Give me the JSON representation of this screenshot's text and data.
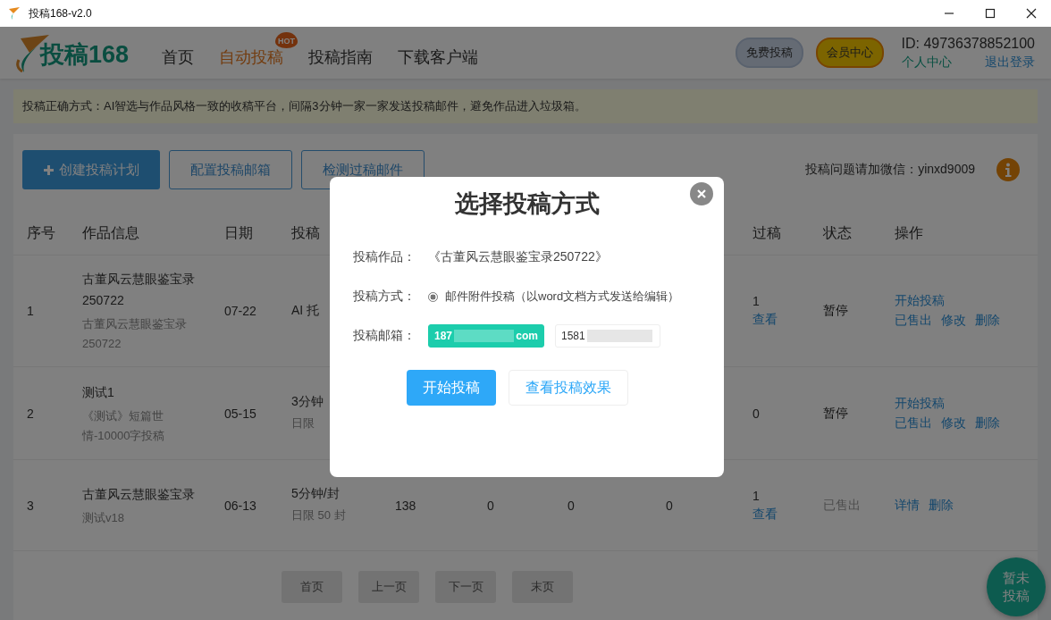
{
  "window": {
    "title": "投稿168-v2.0"
  },
  "header": {
    "logo_text": "投稿168",
    "nav": [
      {
        "label": "首页",
        "selected": false
      },
      {
        "label": "自动投稿",
        "selected": true,
        "badge": "HOT"
      },
      {
        "label": "投稿指南",
        "selected": false
      },
      {
        "label": "下载客户端",
        "selected": false
      }
    ],
    "pills": [
      {
        "label": "免费投稿",
        "kind": "free"
      },
      {
        "label": "会员中心",
        "kind": "vip"
      }
    ],
    "user_id": "ID: 49736378852100",
    "profile_link": "个人中心",
    "logout_link": "退出登录"
  },
  "notice": "投稿正确方式：AI智选与作品风格一致的收稿平台，间隔3分钟一家一家发送投稿邮件，避免作品进入垃圾箱。",
  "toolbar": {
    "buttons": [
      {
        "label": "创建投稿计划",
        "kind": "primary"
      },
      {
        "label": "配置投稿邮箱",
        "kind": "outline"
      },
      {
        "label": "检测过稿邮件",
        "kind": "outline"
      }
    ],
    "contact": "投稿问题请加微信：yinxd9009"
  },
  "table": {
    "columns": [
      "序号",
      "作品信息",
      "日期",
      "投稿",
      null,
      null,
      null,
      null,
      "过稿",
      "状态",
      "操作"
    ],
    "rows": [
      {
        "index": "1",
        "title": "古董风云慧眼鉴宝录250722",
        "subtitle": "古董风云慧眼鉴宝录250722",
        "date": "07-22",
        "rate": "AI 托",
        "cells": [],
        "passed": "1",
        "view": "查看",
        "status": "暂停",
        "greyed": false,
        "actions": [
          [
            "开始投稿"
          ],
          [
            "已售出",
            "修改",
            "删除"
          ]
        ]
      },
      {
        "index": "2",
        "title": "测试1",
        "subtitle": "《测试》短篇世情-10000字投稿",
        "date": "05-15",
        "rate": "3分钟",
        "limit": "日限",
        "cells": [],
        "passed": "0",
        "status": "暂停",
        "greyed": false,
        "actions": [
          [
            "开始投稿"
          ],
          [
            "已售出",
            "修改",
            "删除"
          ]
        ]
      },
      {
        "index": "3",
        "title": "古董风云慧眼鉴宝录",
        "subtitle": "测试v18",
        "date": "06-13",
        "rate": "5分钟/封",
        "limit": "日限 50 封",
        "cells": [
          "138",
          "0",
          "0",
          "0"
        ],
        "passed": "1",
        "view": "查看",
        "status": "已售出",
        "greyed": true,
        "actions": [
          [
            "详情",
            "删除"
          ]
        ]
      }
    ]
  },
  "pagination": [
    {
      "label": "首页",
      "disabled": true
    },
    {
      "label": "上一页",
      "disabled": true
    },
    {
      "label": "下一页",
      "disabled": true
    },
    {
      "label": "末页",
      "disabled": true
    }
  ],
  "float_button": "暂未投稿",
  "dialog": {
    "title": "选择投稿方式",
    "work_label": "投稿作品：",
    "work": "《古董风云慧眼鉴宝录250722》",
    "method_label": "投稿方式：",
    "methods": [
      {
        "label": "邮件附件投稿（以word文档方式发送给编辑）",
        "selected": true
      }
    ],
    "email_label": "投稿邮箱：",
    "emails": [
      {
        "prefix": "187",
        "suffix": "com",
        "selected": true
      },
      {
        "prefix": "1581",
        "selected": false
      }
    ],
    "buttons": [
      {
        "label": "开始投稿",
        "kind": "primary"
      },
      {
        "label": "查看投稿效果",
        "kind": "outline"
      }
    ]
  }
}
